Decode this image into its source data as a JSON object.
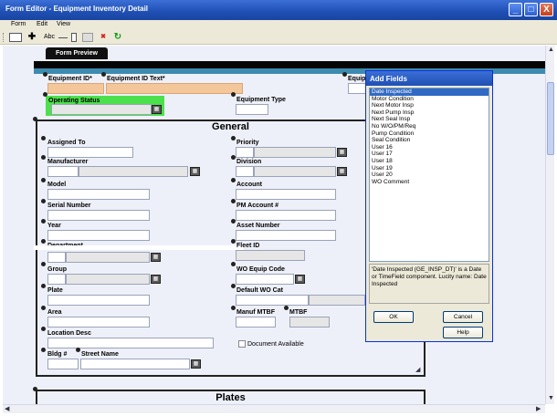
{
  "window": {
    "title": "Form Editor - Equipment Inventory Detail",
    "minimize": "_",
    "maximize": "□",
    "close": "X"
  },
  "menu": [
    "Form",
    "Edit",
    "View"
  ],
  "toolbar": {
    "abc": "Abc",
    "delete": "✖"
  },
  "tab": {
    "label": "Form Preview"
  },
  "header_fields": {
    "equipment_id": "Equipment ID*",
    "equipment_id_text": "Equipment ID Text*",
    "equip_cut": "Equip",
    "operating_status": "Operating Status",
    "equipment_type": "Equipment Type"
  },
  "general": {
    "title": "General",
    "left": [
      "Assigned To",
      "Manufacturer",
      "Model",
      "Serial Number",
      "Year",
      "Department",
      "Group",
      "Plate",
      "Area",
      "Location Desc",
      "Bldg #",
      "Street Name"
    ],
    "right": [
      "Priority",
      "Division",
      "Account",
      "PM Account #",
      "Asset Number",
      "Fleet ID",
      "WO Equip Code",
      "Default WO Cat",
      "Manuf MTBF",
      "MTBF"
    ],
    "document_available": "Document Available"
  },
  "plates": {
    "title": "Plates"
  },
  "add_fields": {
    "title": "Add Fields",
    "items": [
      "Date Inspected",
      "Motor Condition",
      "Next Motor Insp",
      "Next Pump Insp",
      "Next Seal Insp",
      "No W/O/PM/Req",
      "Pump Condition",
      "Seal Condition",
      "User 16",
      "User 17",
      "User 18",
      "User 19",
      "User 20",
      "WO Comment"
    ],
    "selected": "Date Inspected",
    "description": "'Date Inspected (GE_INSP_DT)' is a Date or TimeField component. Lucity name: Date Inspected",
    "ok": "OK",
    "cancel": "Cancel",
    "help": "Help"
  },
  "colors": {
    "titlebar": "#1f4fb4",
    "status_green": "#4ce04c",
    "teal": "#3e8bb0",
    "peach": "#f3c79a"
  }
}
